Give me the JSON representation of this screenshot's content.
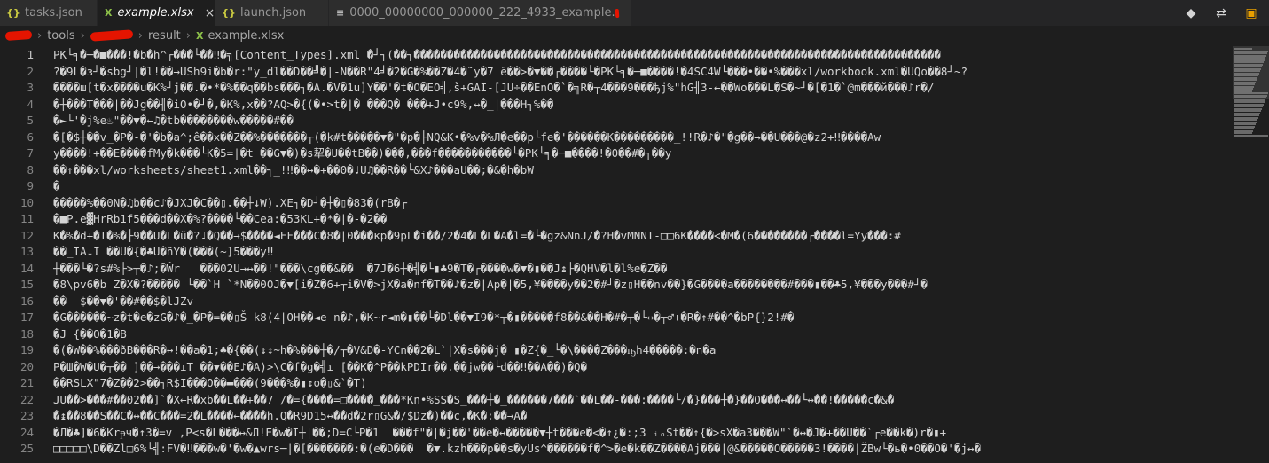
{
  "tabs": [
    {
      "label": "tasks.json",
      "icon": "{}",
      "kind": "json"
    },
    {
      "label": "example.xlsx",
      "icon": "X",
      "kind": "xlsx",
      "active": true
    },
    {
      "label": "launch.json",
      "icon": "{}",
      "kind": "json"
    },
    {
      "label": "0000_00000000_000000_222_4933_example.",
      "icon": "≡",
      "kind": "file"
    }
  ],
  "tab_close_glyph": "×",
  "tab_actions": {
    "open_changes_icon": "◆",
    "compare_icon": "⇄",
    "preview_icon": "▣"
  },
  "breadcrumb": {
    "items": [
      "tools",
      "result",
      "example.xlsx"
    ]
  },
  "lines": [
    {
      "n": "1",
      "text": "PK└╕�─�■���!�b�h^┌���└��‼�╗[Content_Types].xml �┘┐(��┐�������������������������������������������������������������������������������"
    },
    {
      "n": "2",
      "text": "?�9L�з┘�sbg┘|�l!��→USh9i�b�r:\"y_dl��D��╝�|-N��R\"4╛�2�G�%��Z�4�˜y�7 ë��>�▼��┌����└�PK└╕�─■����!�4SC4W└���•��•%���xl/workbook.xml�UQo��8┘~?"
    },
    {
      "n": "3",
      "text": "����ш[t�x����u�K%┘j��.�•*�%��q��bs���┐�A.�V�1u]Y��'�t�O�EO╣,š+GAI-[JU÷��EnO�`�╗R�┬4���9���ђj%\"hG╢З-←��Wo���L�S�~┘�[�1�`@m���й���♪r�/"
    },
    {
      "n": "4",
      "text": "�┼���T���|��Jg��╢�iO•�┘�,�K%,x��?AQ>�{(�•>t�|� ���Q� ���+J•c9%,↔�_|���H┐%��"
    },
    {
      "n": "5",
      "text": "�►└'�j%e♨\"��▼�←♫�tb��������w�����#��"
    },
    {
      "n": "6",
      "text": "�[�$┼��v_�P�-�'�b�a^;ê��x��Z��%�������┬(�k#t�����▼�\"�p�├NQ&K•�%v�%Л�e��p└fe�'������K���������_!!R�♪�\"�g��→��U���@�z2+‼����Aw"
    },
    {
      "n": "7",
      "text": "y����!+��E����fMy�k���└K�5=|�t ��G▼�)�s㸷�U��tB��)���,���f�����������└�PK└╕�─■����!�0��#�┐��y"
    },
    {
      "n": "8",
      "text": "��↑���xl/worksheets/sheet1.xml��┐_!‼��↔�+��0�♩U♫��R��└&X♪���aU��;�&�h�bW"
    },
    {
      "n": "9",
      "text": "�"
    },
    {
      "n": "10",
      "text": "�����%��0N�♫b��c♪�JXJ�C��▯♩��┼↓W).XE┐�D┘�┼�▯�83�(rB�┌"
    },
    {
      "n": "11",
      "text": "�■P.e▓HrRb1f5���d��X�%?����└��Cea:�53KL+�*�|�-�2��"
    },
    {
      "n": "12",
      "text": "K�%�d+�I�%�├9��U�L�ü�?♩�Q��→$����◄EF���C�8�|0���кр�9pL�i��/2�4�L�L�A�l=�└�gz&NnJ/�?H�vMNNT-□□6K����<�M�(6��������┌����l=Yy���:#"
    },
    {
      "n": "13",
      "text": "��_IA↓I ��U�{�♣U�ñY�(���(~]5���y‼"
    },
    {
      "n": "14",
      "text": "┼���└�?s#%├>┬�♪;�Ŵr   ���02U→↔��!\"���\\cg��&��  �7J�6┼�╣�└▮♣9�T�┌����w�▼�▮��J↨├�QHV�l�l%e�Z��"
    },
    {
      "n": "15",
      "text": "�8\\pv6�b Z�X�?����� └��`H `*N��0OJ�▼[i�Z�6+┬i�V�>jX�a�nf�T��♪�z�|Ap�|�5,¥����y��2�#┘�z▯H��nv��}�G����a��������#���▮��♣5,¥���y���#┘�"
    },
    {
      "n": "16",
      "text": "��  $��▼�'��#��$�lJZv"
    },
    {
      "n": "17",
      "text": "�G������~z�t�e�zG�♪�_�P�=��▯Š k8(4|OH��◄e n�♪,�K~r◄m�▮��└�Dl��▼I9�*┬�▮�����f8��&��H�#�┬�└↔�┬♂+�R�↑#��^�bP{}2!#�"
    },
    {
      "n": "18",
      "text": "�J {��O�1�B"
    },
    {
      "n": "19",
      "text": "�(�W��%���ðB���R�↔!��a�1;♣�{��(↕↕~h�%���┼�/┬�V&D�-YCn��2�L`|X�s���j� ▮�Z{�_└�\\����Z���ҧh4�����:�n�a"
    },
    {
      "n": "20",
      "text": "P�Ш�W�U�┬��_]��→���ıT ��▼��E♪�A)>\\C�f�g�╣ɿ_[��K�^P��kPDIr��.��jw��└d��‼��A��)�Q�"
    },
    {
      "n": "21",
      "text": "��RSLX\"7�Z��2>��┐R$I���O��▬���(9���%�▮↕o�▯&`�T)"
    },
    {
      "n": "22",
      "text": "JU��>���#��02��]`�X←R�xb��L��+��7 /�={����=□����_���*Kn•%SS�S_���┼�_������7���`��L��-���:����└/�}���┼�}��O���↔��└↔��!�����c�&�"
    },
    {
      "n": "23",
      "text": "�↨��8��S��C�↔��C���=2�L����←����h.Q�R9D15↔��d�2r▯G&�/$Dz�)��c,�K�:��→A�"
    },
    {
      "n": "24",
      "text": "�Л�♣]�6�Krᵽч�↑3�=v ,P<s�L���↔&Л!E�w�I┼|��;D=C└P�1  ���f\"�|�j��'��e�↔�����▼┼t���e�<�↑¿�:;3 ᵢₒSt��↑{�>sX�a3���W\"`�↔�J�+��U��`┌e��k�)r�▮+"
    },
    {
      "n": "25",
      "text": "□□□□□\\D��Zl□6%└╣:FV�‼���w�'�w�▲wrs─|�[�������:�(e�D���  �▼.kzh���p��s�yUs^������f�^>�e�k��Z����Aj���|@&�����O�����3!����|ŽBw└�ь�•0��O�'�j↔�"
    }
  ],
  "current_line": "1"
}
